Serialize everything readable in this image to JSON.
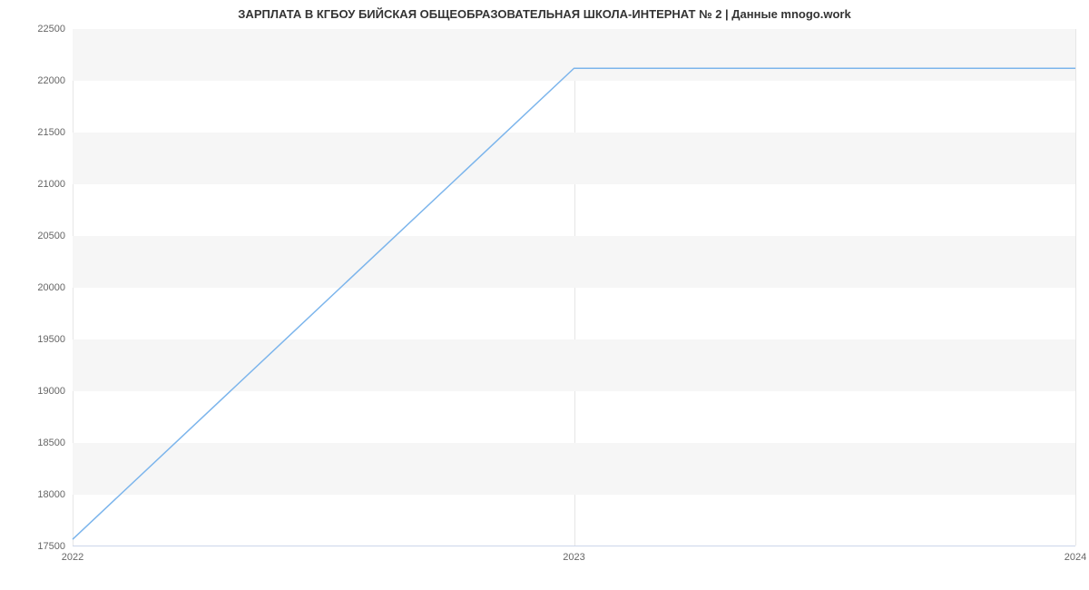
{
  "chart_data": {
    "type": "line",
    "title": "ЗАРПЛАТА В КГБОУ БИЙСКАЯ ОБЩЕОБРАЗОВАТЕЛЬНАЯ ШКОЛА-ИНТЕРНАТ № 2 | Данные mnogo.work",
    "xlabel": "",
    "ylabel": "",
    "x": [
      2022,
      2023,
      2024
    ],
    "series": [
      {
        "name": "salary",
        "values": [
          17560,
          22120,
          22120
        ]
      }
    ],
    "x_ticks": [
      2022,
      2023,
      2024
    ],
    "y_ticks": [
      17500,
      18000,
      18500,
      19000,
      19500,
      20000,
      20500,
      21000,
      21500,
      22000,
      22500
    ],
    "ylim": [
      17500,
      22500
    ],
    "xlim": [
      2022,
      2024
    ],
    "colors": {
      "line": "#7cb5ec",
      "band": "#f6f6f6",
      "axis": "#ccd6eb"
    }
  }
}
